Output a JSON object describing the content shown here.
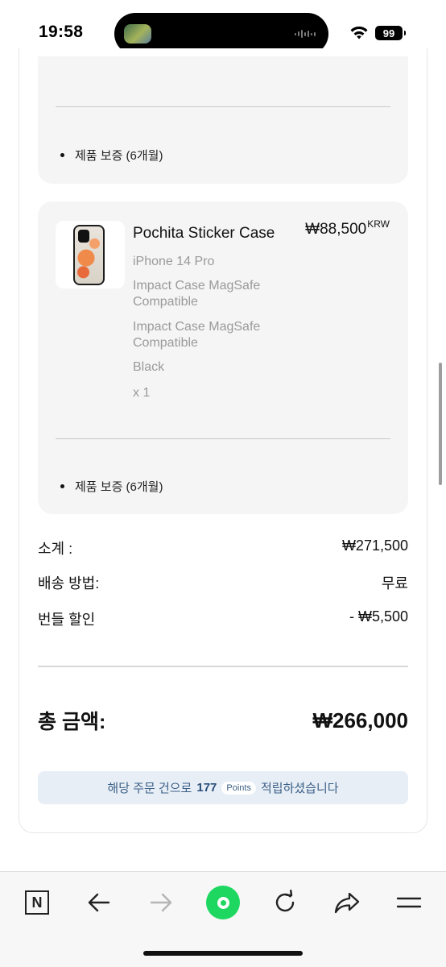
{
  "status_bar": {
    "time": "19:58",
    "battery": "99"
  },
  "order": {
    "previous_item": {
      "warranty": "제품 보증 (6개월)"
    },
    "item": {
      "name": "Pochita Sticker Case",
      "price": "₩88,500",
      "currency": "KRW",
      "options": [
        "iPhone 14 Pro",
        "Impact Case MagSafe Compatible",
        "Impact Case MagSafe Compatible",
        "Black",
        "x 1"
      ],
      "warranty": "제품 보증 (6개월)"
    },
    "summary": {
      "subtotal_label": "소계 :",
      "subtotal_value": "₩271,500",
      "shipping_label": "배송 방법:",
      "shipping_value": "무료",
      "bundle_label": "번들 할인",
      "bundle_value": "- ₩5,500",
      "total_label": "총 금액:",
      "total_value": "₩266,000"
    },
    "points": {
      "prefix": "해당 주문 건으로",
      "amount": "177",
      "unit": "Points",
      "suffix": "적립하셨습니다"
    }
  },
  "toolbar": {
    "n_label": "N",
    "icons": [
      "n-logo-icon",
      "back-arrow-icon",
      "forward-arrow-icon",
      "home-dot-icon",
      "reload-icon",
      "share-icon",
      "menu-icon"
    ]
  },
  "colors": {
    "card_bg": "#f5f5f5",
    "points_bg": "#e7eef6",
    "points_text": "#3b5f86",
    "home_green": "#1ed760"
  }
}
